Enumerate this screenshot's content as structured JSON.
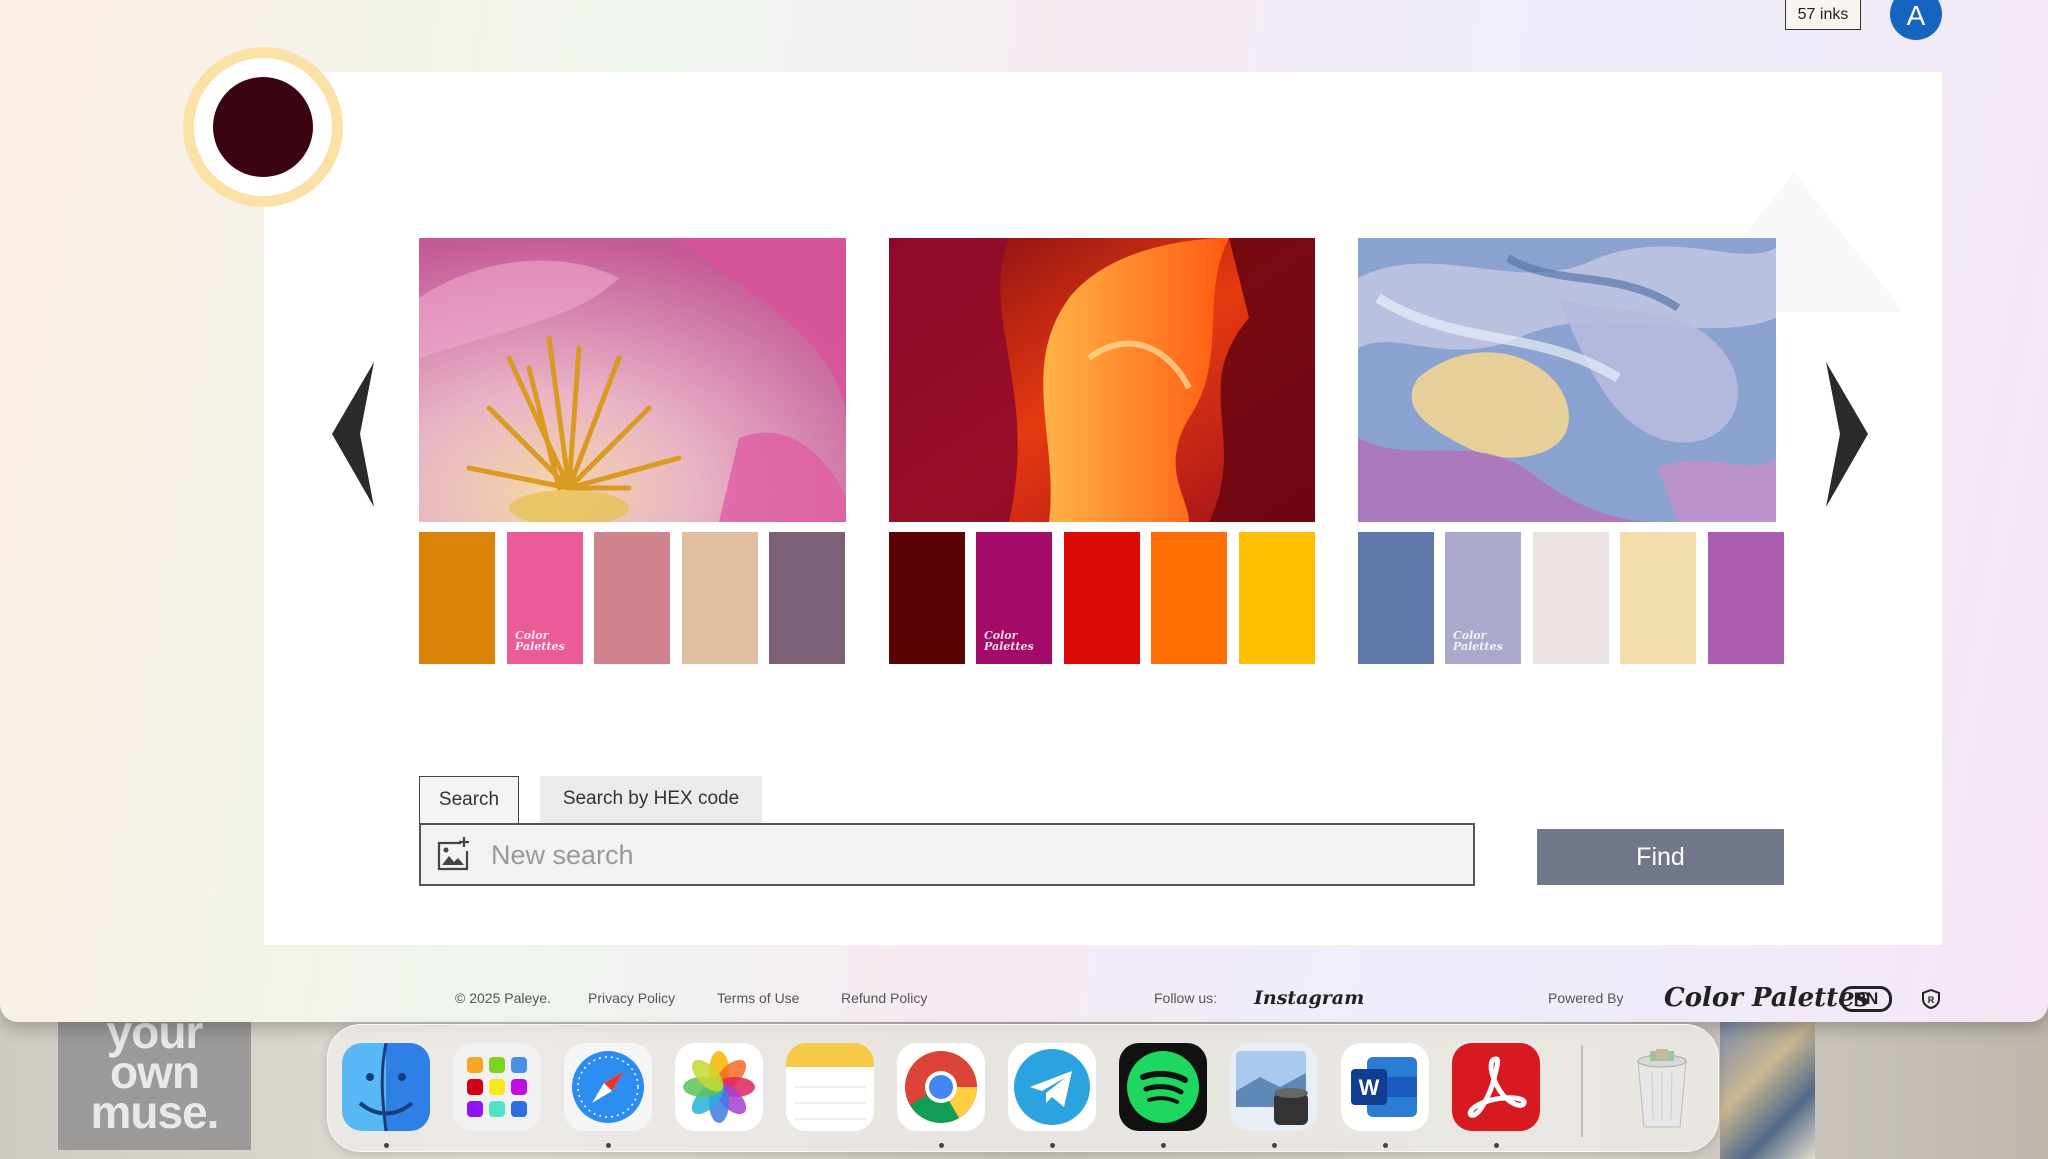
{
  "header": {
    "inks_label": "57 inks",
    "avatar_letter": "A"
  },
  "palettes": [
    {
      "image": "pink flower close-up",
      "colors": [
        "#DB8306",
        "#E95C97",
        "#D0858E",
        "#E2BEA0",
        "#7D5F76"
      ],
      "label_line1": "Color",
      "label_line2": "Palettes"
    },
    {
      "image": "red canyon rock",
      "colors": [
        "#5B0406",
        "#A30B69",
        "#DB0A04",
        "#FF6E03",
        "#FFBF00"
      ],
      "label_line1": "Color",
      "label_line2": "Palettes"
    },
    {
      "image": "blue purple paint swirls",
      "colors": [
        "#5F7AA8",
        "#AAA8CB",
        "#EAE3E1",
        "#F4DEAB",
        "#AC5CAE"
      ],
      "label_line1": "Color",
      "label_line2": "Palettes"
    }
  ],
  "search": {
    "tabs": [
      "Search",
      "Search by HEX code"
    ],
    "placeholder": "New search",
    "find_label": "Find"
  },
  "footer": {
    "copyright": "© 2025 Paleye.",
    "privacy": "Privacy Policy",
    "terms": "Terms of Use",
    "refund": "Refund Policy",
    "follow": "Follow us:",
    "instagram": "Instagram",
    "powered": "Powered By",
    "brand": "Color Palettes",
    "rn": "RN"
  },
  "wallpaper_text": [
    "your",
    "own",
    "muse."
  ],
  "dock": {
    "apps": [
      "finder-icon",
      "launchpad-icon",
      "safari-icon",
      "photos-icon",
      "notes-icon",
      "chrome-icon",
      "telegram-icon",
      "spotify-icon",
      "preview-icon",
      "word-icon",
      "acrobat-icon",
      "trash-icon"
    ]
  }
}
